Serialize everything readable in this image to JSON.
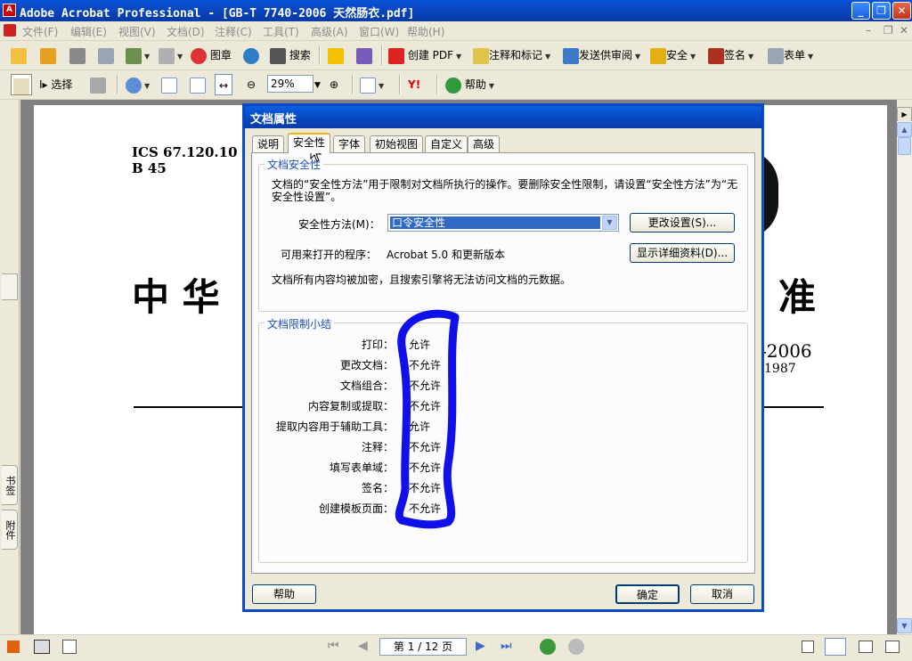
{
  "window": {
    "title": "Adobe Acrobat Professional - [GB-T 7740-2006 天然肠衣.pdf]",
    "minimize": "_",
    "restore": "❐",
    "close": "✕"
  },
  "menu": [
    "文件(F)",
    "编辑(E)",
    "视图(V)",
    "文档(D)",
    "注释(C)",
    "工具(T)",
    "高级(A)",
    "窗口(W)",
    "帮助(H)"
  ],
  "toolbar1": {
    "stamp": "图章",
    "search": "搜索",
    "create_pdf": "创建 PDF",
    "comment_markup": "注释和标记",
    "send_review": "发送供审阅",
    "security": "安全",
    "sign": "签名",
    "forms": "表单"
  },
  "toolbar2": {
    "select": "选择",
    "zoom": "29%",
    "help": "帮助"
  },
  "doc": {
    "ics": "ICS 67.120.10",
    "b45": "B 45",
    "heading_left": "中 华",
    "heading_right": "准",
    "std_year": "-2006",
    "replaces": "—1987"
  },
  "dialog": {
    "title": "文档属性",
    "tabs": [
      "说明",
      "安全性",
      "字体",
      "初始视图",
      "自定义",
      "高级"
    ],
    "security_group": {
      "title": "文档安全性",
      "desc_line1": "文档的“安全性方法”用于限制对文档所执行的操作。要删除安全性限制，请设置“安全性方法”为“无",
      "desc_line2": "安全性设置”。",
      "method_label": "安全性方法(M)：",
      "method_value": "口令安全性",
      "change_button": "更改设置(S)...",
      "open_with_label": "可用来打开的程序：",
      "open_with_value": "Acrobat 5.0 和更新版本",
      "details_button": "显示详细资料(D)...",
      "encrypted_note": "文档所有内容均被加密，且搜索引擎将无法访问文档的元数据。"
    },
    "restrictions": {
      "title": "文档限制小结",
      "rows": [
        {
          "label": "打印：",
          "value": "允许"
        },
        {
          "label": "更改文档：",
          "value": "不允许"
        },
        {
          "label": "文档组合：",
          "value": "不允许"
        },
        {
          "label": "内容复制或提取：",
          "value": "不允许"
        },
        {
          "label": "提取内容用于辅助工具：",
          "value": "允许"
        },
        {
          "label": "注释：",
          "value": "不允许"
        },
        {
          "label": "填写表单域：",
          "value": "不允许"
        },
        {
          "label": "签名：",
          "value": "不允许"
        },
        {
          "label": "创建模板页面：",
          "value": "不允许"
        }
      ]
    },
    "help_button": "帮助",
    "ok_button": "确定",
    "cancel_button": "取消"
  },
  "left_tabs": [
    "书签",
    "附件"
  ],
  "status": {
    "page_indicator": "第 1 / 12 页"
  }
}
